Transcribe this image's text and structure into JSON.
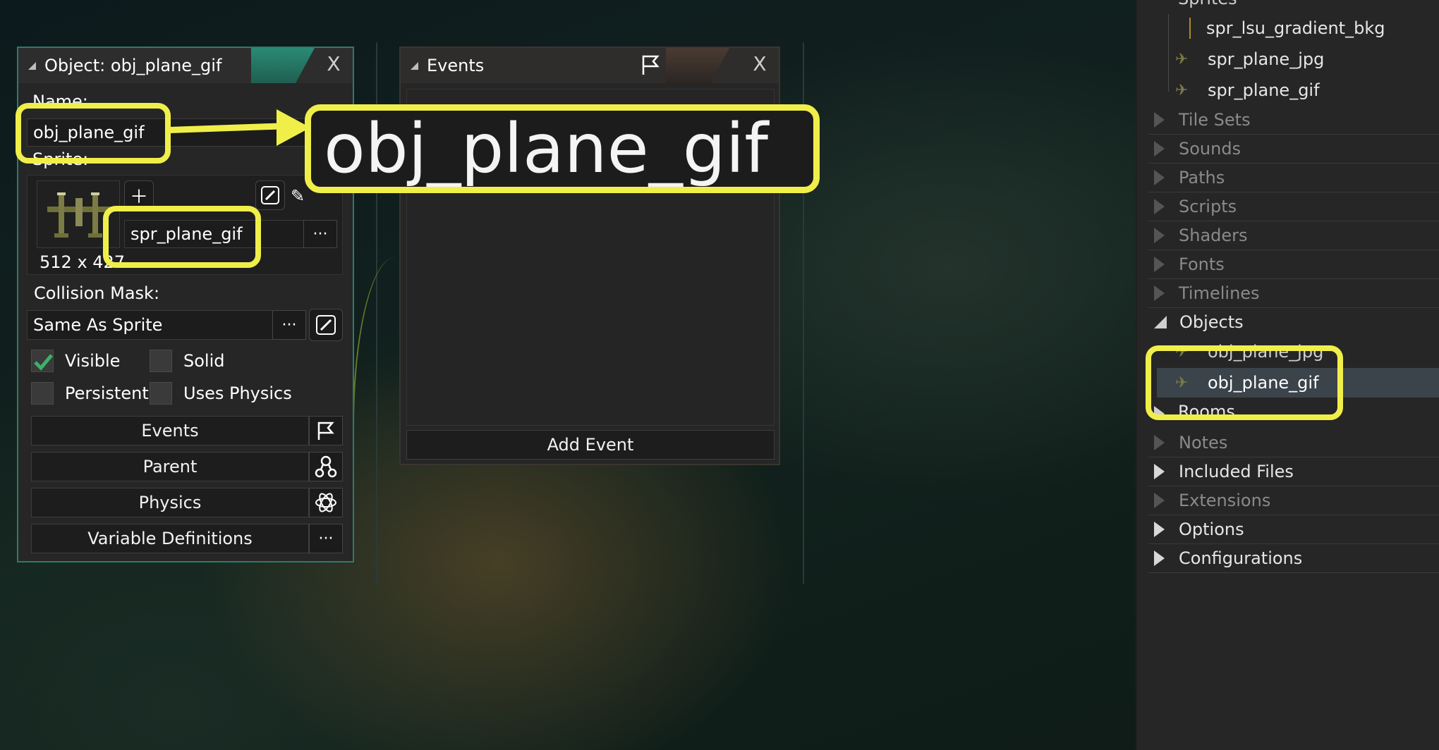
{
  "object_panel": {
    "title": "Object: obj_plane_gif",
    "close": "X",
    "name_label": "Name:",
    "name_value": "obj_plane_gif",
    "sprite_label": "Sprite:",
    "sprite_value": "spr_plane_gif",
    "sprite_size": "512 x 427",
    "collision_label": "Collision Mask:",
    "collision_value": "Same As Sprite",
    "ellipsis": "···",
    "visible_label": "Visible",
    "visible_checked": true,
    "solid_label": "Solid",
    "solid_checked": false,
    "persistent_label": "Persistent",
    "persistent_checked": false,
    "physics_check_label": "Uses Physics",
    "physics_checked": false,
    "buttons": [
      "Events",
      "Parent",
      "Physics",
      "Variable Definitions"
    ]
  },
  "events_panel": {
    "title": "Events",
    "close": "X",
    "add_event": "Add Event"
  },
  "callout": {
    "zoom_text": "obj_plane_gif",
    "color": "#f0ef4a"
  },
  "resource_tree": {
    "sprites_header": "Sprites",
    "sprite_items": [
      "spr_lsu_gradient_bkg",
      "spr_plane_jpg",
      "spr_plane_gif"
    ],
    "groups_before_objects": [
      "Tile Sets",
      "Sounds",
      "Paths",
      "Scripts",
      "Shaders",
      "Fonts",
      "Timelines"
    ],
    "objects_header": "Objects",
    "object_items": [
      "obj_plane_jpg",
      "obj_plane_gif"
    ],
    "selected_item": "obj_plane_gif",
    "rooms_header": "Rooms",
    "groups_after": [
      "Notes",
      "Included Files",
      "Extensions",
      "Options",
      "Configurations"
    ]
  },
  "colors": {
    "accent_teal": "#2f7a66",
    "highlight_yellow": "#f0ef4a",
    "selected_row": "#3b434b",
    "check_green": "#39b36a"
  }
}
